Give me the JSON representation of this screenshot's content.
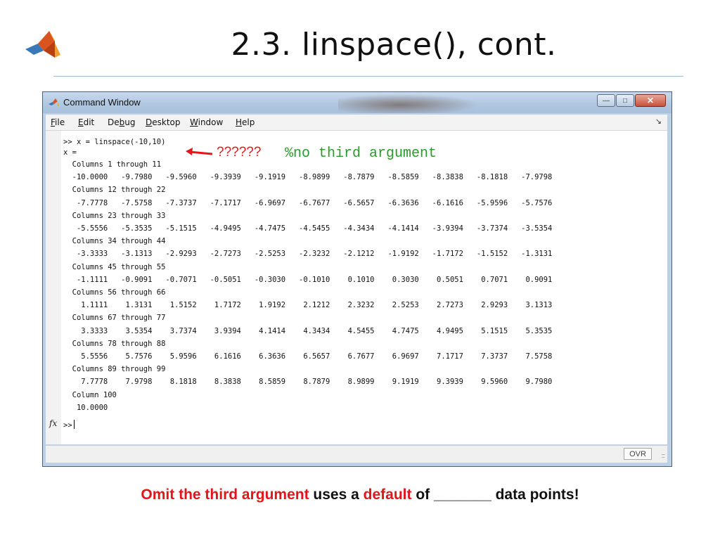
{
  "slide": {
    "title": "2.3. linspace(), cont."
  },
  "window": {
    "title": "Command Window",
    "buttons": {
      "minimize": "—",
      "maximize": "□",
      "close": "✕"
    }
  },
  "menubar": {
    "items": [
      {
        "u": "F",
        "rest": "ile"
      },
      {
        "u": "E",
        "rest": "dit"
      },
      {
        "pre": "De",
        "u": "b",
        "rest": "ug"
      },
      {
        "u": "D",
        "rest": "esktop"
      },
      {
        "u": "W",
        "rest": "indow"
      },
      {
        "u": "H",
        "rest": "elp"
      }
    ],
    "arrow": "↘"
  },
  "console": {
    "lines": [
      ">> x = linspace(-10,10)",
      "x =",
      "  Columns 1 through 11",
      "  -10.0000   -9.7980   -9.5960   -9.3939   -9.1919   -8.9899   -8.7879   -8.5859   -8.3838   -8.1818   -7.9798",
      "  Columns 12 through 22",
      "   -7.7778   -7.5758   -7.3737   -7.1717   -6.9697   -6.7677   -6.5657   -6.3636   -6.1616   -5.9596   -5.7576",
      "  Columns 23 through 33",
      "   -5.5556   -5.3535   -5.1515   -4.9495   -4.7475   -4.5455   -4.3434   -4.1414   -3.9394   -3.7374   -3.5354",
      "  Columns 34 through 44",
      "   -3.3333   -3.1313   -2.9293   -2.7273   -2.5253   -2.3232   -2.1212   -1.9192   -1.7172   -1.5152   -1.3131",
      "  Columns 45 through 55",
      "   -1.1111   -0.9091   -0.7071   -0.5051   -0.3030   -0.1010    0.1010    0.3030    0.5051    0.7071    0.9091",
      "  Columns 56 through 66",
      "    1.1111    1.3131    1.5152    1.7172    1.9192    2.1212    2.3232    2.5253    2.7273    2.9293    3.1313",
      "  Columns 67 through 77",
      "    3.3333    3.5354    3.7374    3.9394    4.1414    4.3434    4.5455    4.7475    4.9495    5.1515    5.3535",
      "  Columns 78 through 88",
      "    5.5556    5.7576    5.9596    6.1616    6.3636    6.5657    6.7677    6.9697    7.1717    7.3737    7.5758",
      "  Columns 89 through 99",
      "    7.7778    7.9798    8.1818    8.3838    8.5859    8.7879    8.9899    9.1919    9.3939    9.5960    9.7980",
      "  Column 100",
      "   10.0000"
    ],
    "prompt": ">>",
    "fx": "fx"
  },
  "annotation": {
    "question": "??????",
    "comment": "%no third argument",
    "arrow_color": "#e8161c"
  },
  "status": {
    "ovr": "OVR",
    "grip": ":::"
  },
  "caption": {
    "part1": "Omit the third argument",
    "part2": " uses a ",
    "part3": "default",
    "part4": " of _______ data points!"
  },
  "colors": {
    "accent_red": "#e0161a",
    "comment_green": "#2a9a2a",
    "title_rule": "#9fb6cf"
  }
}
